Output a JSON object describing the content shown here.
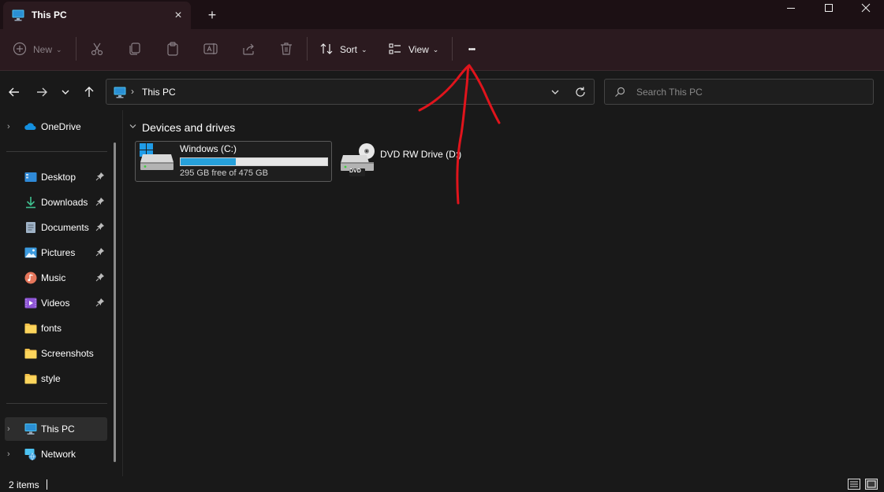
{
  "window": {
    "tab_title": "This PC",
    "tab_close": "×",
    "new_tab": "+"
  },
  "toolbar": {
    "new_label": "New",
    "sort_label": "Sort",
    "view_label": "View",
    "more_label": "•••",
    "icons": [
      "add-icon",
      "cut-icon",
      "copy-icon",
      "paste-icon",
      "rename-icon",
      "share-icon",
      "delete-icon",
      "sort-icon",
      "view-icon"
    ]
  },
  "address": {
    "separator": "›",
    "path": "This PC"
  },
  "search": {
    "placeholder": "Search This PC"
  },
  "sidebar": {
    "items": [
      {
        "label": "OneDrive",
        "icon": "onedrive-icon"
      },
      {
        "label": "Desktop",
        "icon": "desktop-icon",
        "pinned": true
      },
      {
        "label": "Downloads",
        "icon": "downloads-icon",
        "pinned": true
      },
      {
        "label": "Documents",
        "icon": "documents-icon",
        "pinned": true
      },
      {
        "label": "Pictures",
        "icon": "pictures-icon",
        "pinned": true
      },
      {
        "label": "Music",
        "icon": "music-icon",
        "pinned": true
      },
      {
        "label": "Videos",
        "icon": "videos-icon",
        "pinned": true
      },
      {
        "label": "fonts",
        "icon": "folder-icon"
      },
      {
        "label": "Screenshots",
        "icon": "folder-icon"
      },
      {
        "label": "style",
        "icon": "folder-icon"
      },
      {
        "label": "This PC",
        "icon": "this-pc-icon",
        "selected": true
      },
      {
        "label": "Network",
        "icon": "network-icon"
      }
    ]
  },
  "main": {
    "group_title": "Devices and drives",
    "drives": [
      {
        "name": "Windows  (C:)",
        "free_text": "295 GB free of 475 GB",
        "used_fraction": 0.379
      },
      {
        "name": "DVD RW Drive (D:)",
        "badge": "DVD"
      }
    ]
  },
  "status": {
    "item_count": "2 items"
  },
  "colors": {
    "accent": "#26a0da",
    "annotation": "#e0141c",
    "titlebar": "#1c1014",
    "commandbar": "#2b1a1f"
  }
}
